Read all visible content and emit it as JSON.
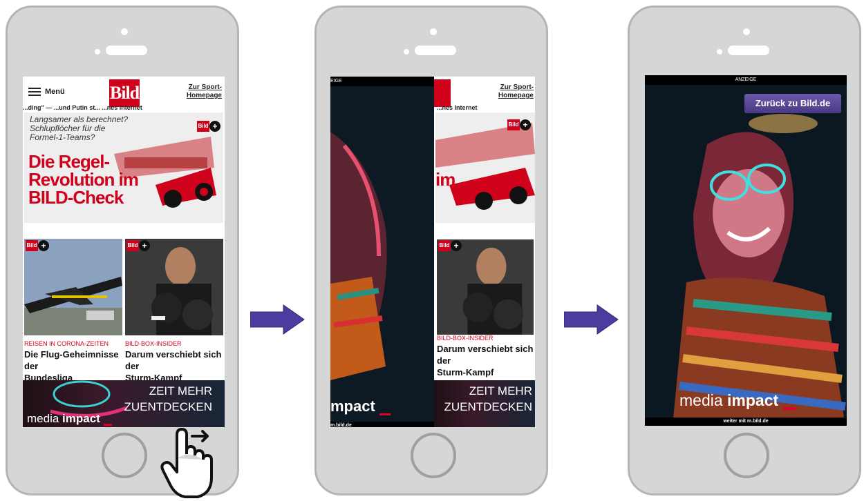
{
  "news_page": {
    "menu_label": "Menü",
    "logo": "Bild",
    "sport_link_line1": "Zur Sport-",
    "sport_link_line2": "Homepage",
    "ticker": "...ding\" — ...und Putin st... ...nes Internet",
    "hero": {
      "sub_line1": "Langsamer als berechnet?",
      "sub_line2": "Schlupflöcher für die",
      "sub_line3": "Formel-1-Teams?",
      "title_line1": "Die Regel-",
      "title_line2": "Revolution im",
      "title_line3": "BILD-Check",
      "badge": "Bild"
    },
    "cards": [
      {
        "kicker": "REISEN IN CORONA-ZEITEN",
        "headline_line1": "Die Flug-Geheimnisse der",
        "headline_line2": "Bundesliga",
        "badge": "Bild"
      },
      {
        "kicker": "BILD-BOX-INSIDER",
        "headline_line1": "Darum verschiebt sich der",
        "headline_line2": "Sturm-Kampf",
        "badge": "Bild"
      }
    ],
    "banner": {
      "line1": "ZEIT MEHR",
      "line2": "ZUENTDECKEN",
      "logo_light": "media",
      "logo_bold": "impact"
    }
  },
  "ad": {
    "top_label": "ANZEIGE",
    "top_label_partial": "EIGE",
    "back_button": "Zurück zu Bild.de",
    "logo_light": "media",
    "logo_bold": "impact",
    "logo_partial": "mpact",
    "bottom_full": "weiter mit m.bild.de",
    "bottom_partial": "m.bild.de"
  },
  "plus_symbol": "+",
  "colors": {
    "bild_red": "#d0021b",
    "arrow": "#4b3d9e",
    "button": "#5a4a98"
  },
  "icons": [
    "menu-icon",
    "plus-icon",
    "swipe-hand-icon",
    "arrow-right-icon"
  ]
}
